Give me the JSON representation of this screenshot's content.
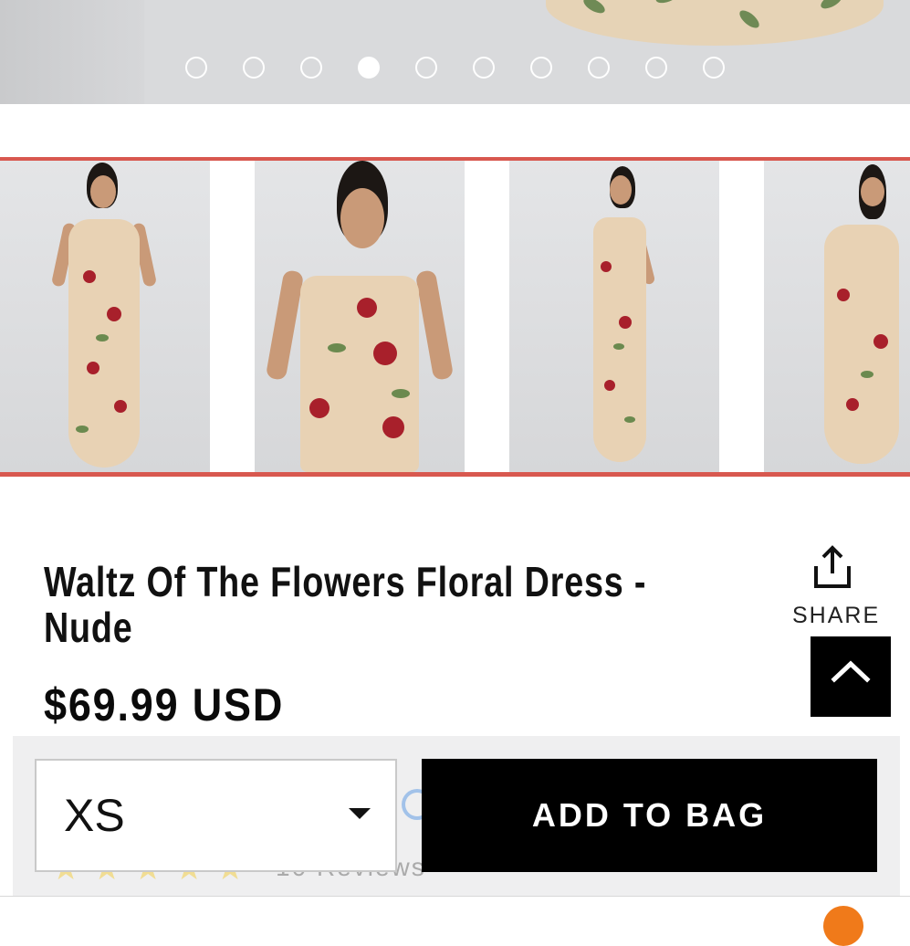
{
  "carousel": {
    "slide_count": 10,
    "active_index": 3
  },
  "thumbnails": [
    {
      "view": "front-full"
    },
    {
      "view": "front-closeup"
    },
    {
      "view": "side"
    },
    {
      "view": "back"
    }
  ],
  "product": {
    "title": "Waltz Of The Flowers Floral Dress - Nude",
    "price": "$69.99 USD"
  },
  "share": {
    "label": "SHARE",
    "icon": "share-icon"
  },
  "back_to_top": {
    "icon": "chevron-up-icon"
  },
  "rating": {
    "stars": 5,
    "reviews_text": "10 Reviews"
  },
  "purchase": {
    "size_selected": "XS",
    "add_to_bag_label": "ADD TO BAG"
  },
  "colors": {
    "accent_red": "#d8584f",
    "black": "#000000",
    "bar_bg": "#efeff0",
    "star": "#f3cf4a"
  }
}
